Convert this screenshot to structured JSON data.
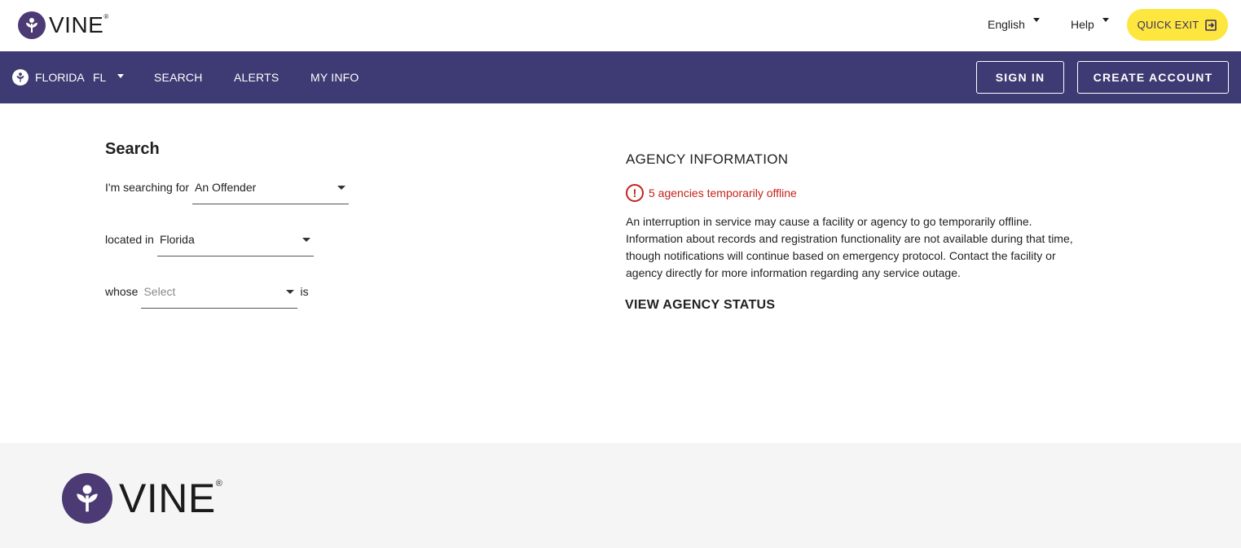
{
  "brand": {
    "name": "VINE",
    "reg": "®"
  },
  "topbar": {
    "language": "English",
    "help": "Help",
    "quick_exit": "QUICK EXIT"
  },
  "nav": {
    "state_name": "FLORIDA",
    "state_code": "FL",
    "links": [
      "SEARCH",
      "ALERTS",
      "MY INFO"
    ],
    "sign_in": "SIGN IN",
    "create_account": "CREATE ACCOUNT"
  },
  "search": {
    "title": "Search",
    "searching_for_label": "I'm searching for",
    "searching_for_value": "An Offender",
    "located_in_label": "located in",
    "located_in_value": "Florida",
    "whose_label": "whose",
    "whose_placeholder": "Select",
    "is_label": "is"
  },
  "agency": {
    "title": "AGENCY INFORMATION",
    "offline_text": "5 agencies temporarily offline",
    "description": "An interruption in service may cause a facility or agency to go temporarily offline. Information about records and registration functionality are not available during that time, though notifications will continue based on emergency protocol. Contact the facility or agency directly for more information regarding any service outage.",
    "view_status": "VIEW AGENCY STATUS"
  },
  "colors": {
    "nav_bg": "#3e3a73",
    "brand_purple": "#4b3a73",
    "quick_exit_bg": "#fde63d",
    "alert_red": "#c4221b",
    "footer_bg": "#f5f5f5"
  },
  "icons": [
    "vine-logo-icon",
    "chevron-down-icon",
    "exit-icon",
    "alert-circle-icon"
  ]
}
